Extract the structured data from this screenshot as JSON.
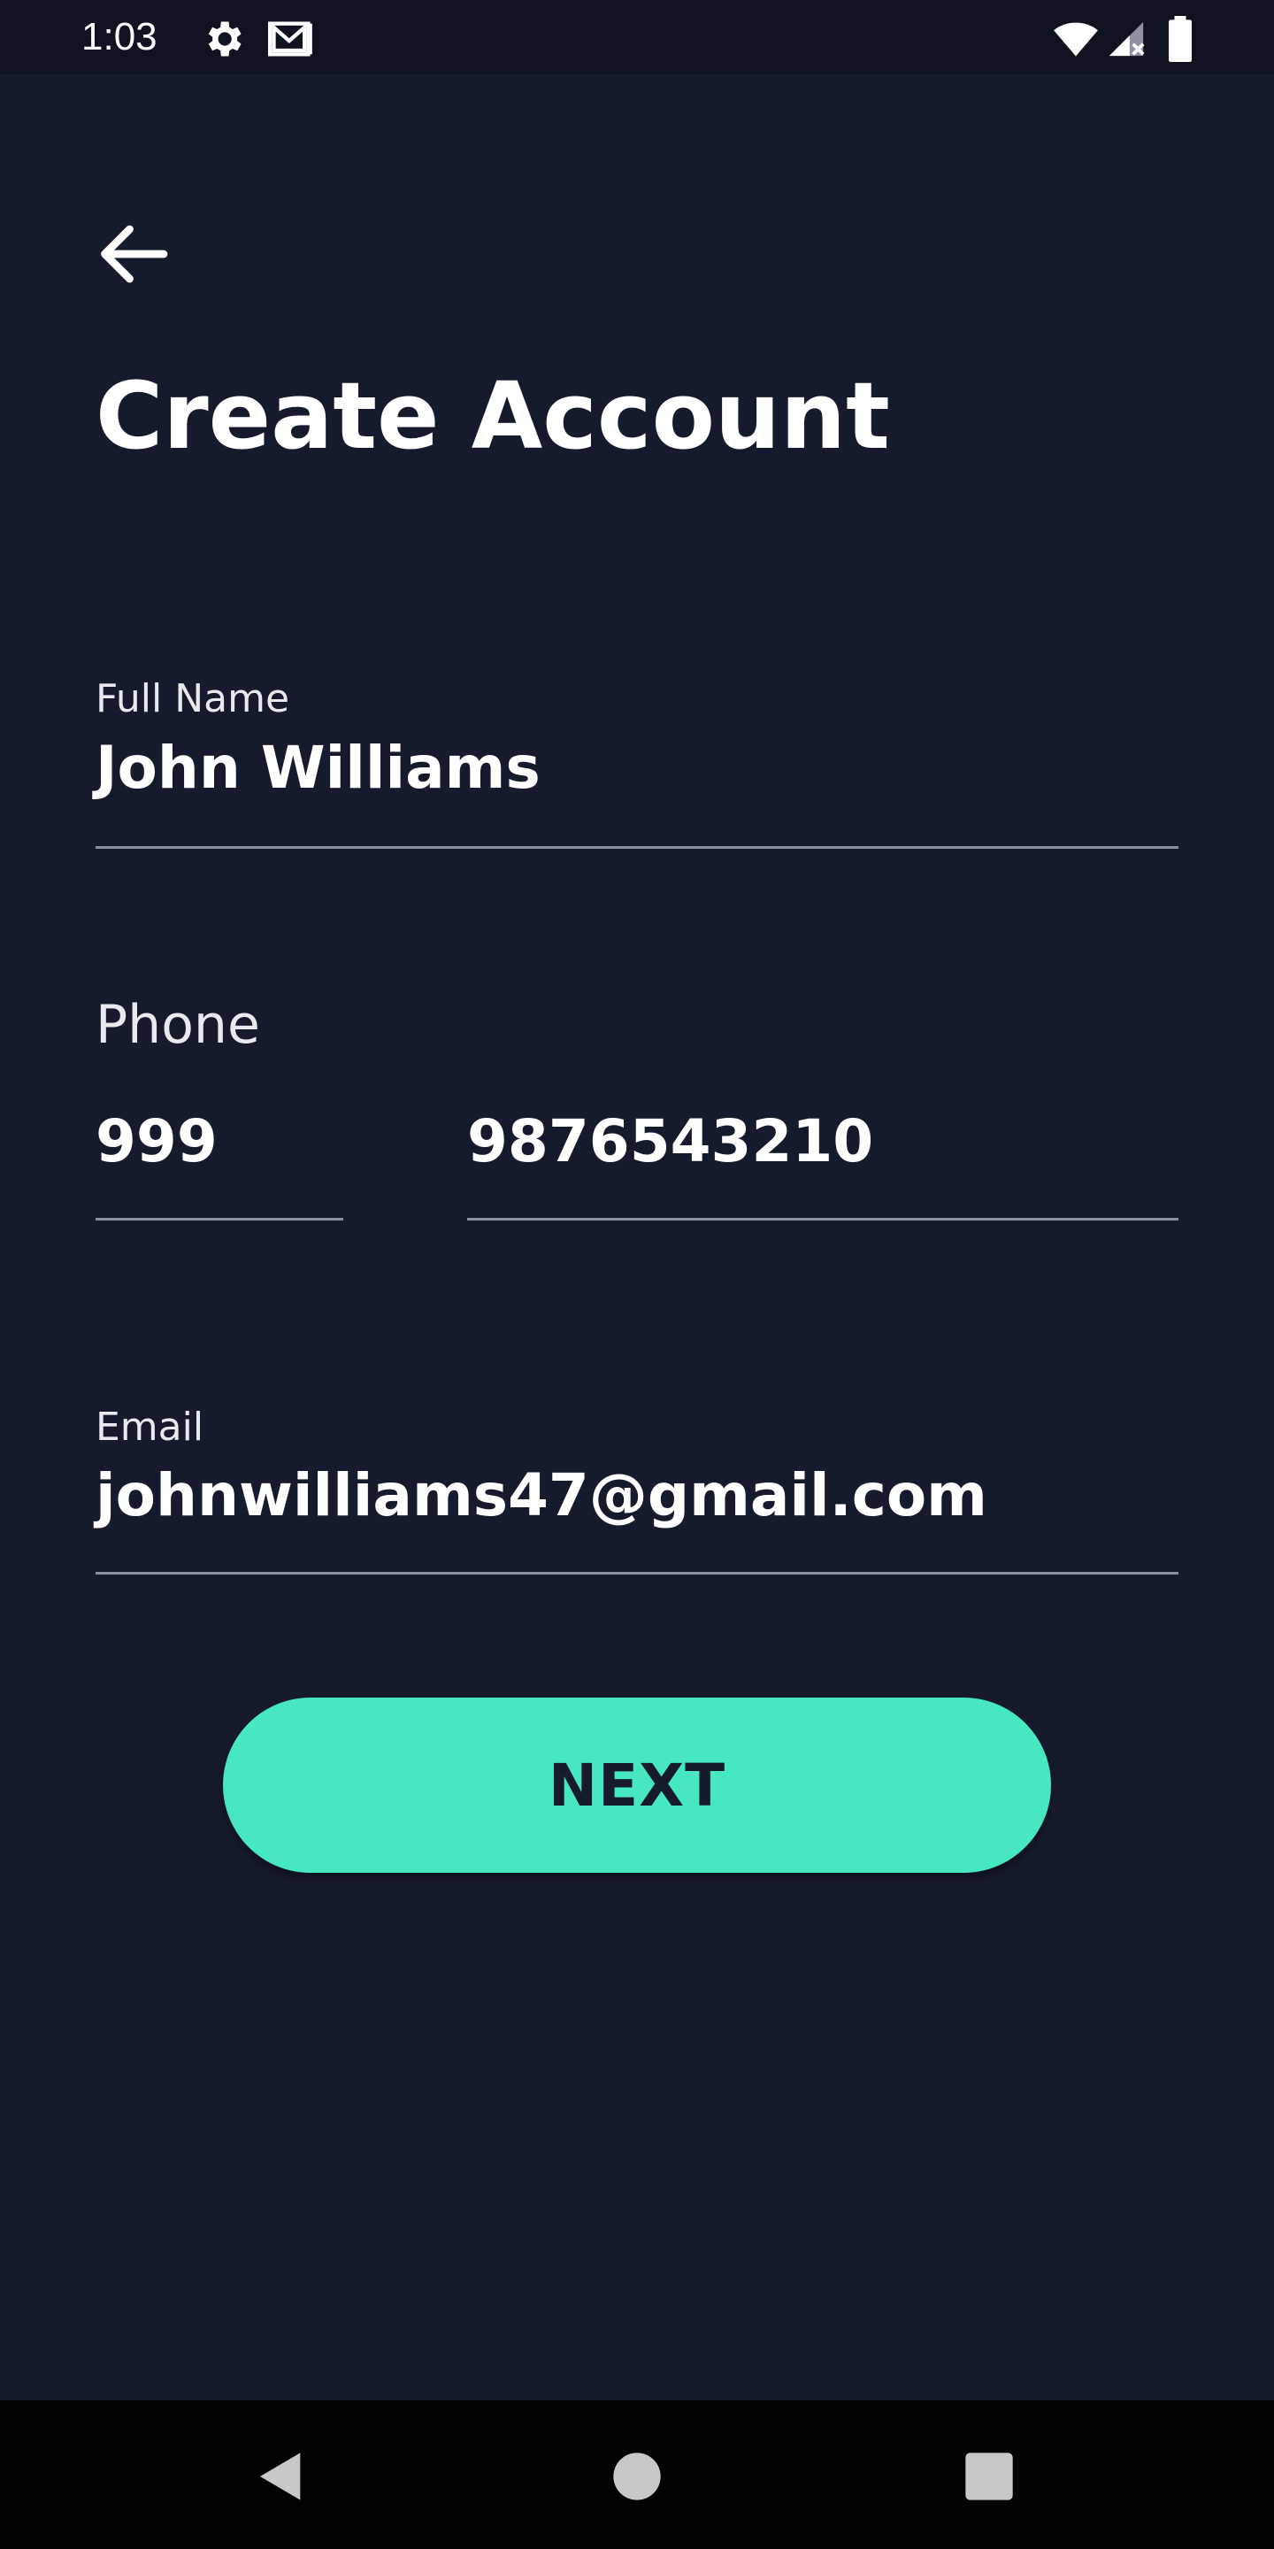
{
  "status_bar": {
    "time": "1:03",
    "icons": [
      "settings-icon",
      "gmail-icon",
      "wifi-icon",
      "cellular-no-signal-icon",
      "battery-icon"
    ]
  },
  "header": {
    "back_icon": "arrow-left-icon",
    "title": "Create Account"
  },
  "form": {
    "full_name": {
      "label": "Full Name",
      "value": "John Williams"
    },
    "phone": {
      "label": "Phone",
      "country_code": "999",
      "number": "9876543210"
    },
    "email": {
      "label": "Email",
      "value": "johnwilliams47@gmail.com"
    }
  },
  "actions": {
    "next_label": "NEXT"
  },
  "nav_bar": {
    "icons": [
      "nav-back-icon",
      "nav-home-icon",
      "nav-recents-icon"
    ]
  },
  "colors": {
    "background": "#161a2d",
    "status_bar": "#0f1221",
    "accent": "#47e8c0",
    "underline": "#8d91a2"
  }
}
